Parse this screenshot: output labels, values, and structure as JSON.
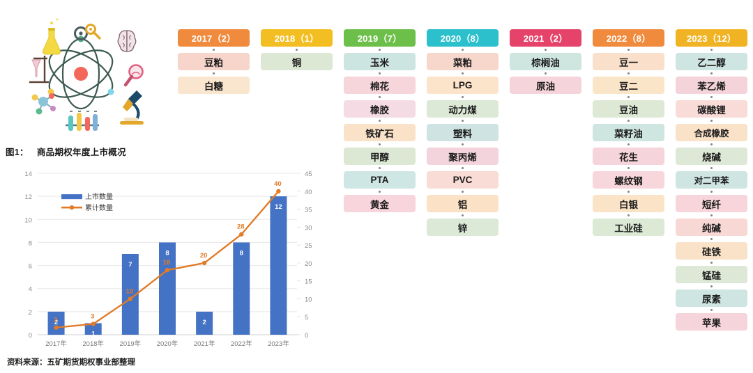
{
  "illustration": {
    "name": "science-illustration",
    "elements": [
      "atom",
      "brain",
      "microscope",
      "flask",
      "magnifier",
      "gears",
      "molecule",
      "test-tubes",
      "beaker-stand"
    ]
  },
  "chart": {
    "title_num": "图1：",
    "title_text": "商品期权年度上市概况",
    "source": "资料来源：五矿期货期权事业部整理",
    "bar_color": "#4472C4",
    "line_color": "#E07B28"
  },
  "chart_data": {
    "type": "bar",
    "title": "图1： 商品期权年度上市概况",
    "categories": [
      "2017年",
      "2018年",
      "2019年",
      "2020年",
      "2021年",
      "2022年",
      "2023年"
    ],
    "series": [
      {
        "name": "上市数量",
        "type": "bar",
        "axis": "left",
        "values": [
          2,
          1,
          7,
          8,
          2,
          8,
          12
        ]
      },
      {
        "name": "累计数量",
        "type": "line",
        "axis": "right",
        "values": [
          2,
          3,
          10,
          18,
          20,
          28,
          40
        ]
      }
    ],
    "xlabel": "",
    "ylabel": "",
    "ylim": [
      0,
      14
    ],
    "y_ticks": [
      0,
      2,
      4,
      6,
      8,
      10,
      12,
      14
    ],
    "y2lim": [
      0,
      45
    ],
    "y2_ticks": [
      0,
      5,
      10,
      15,
      20,
      25,
      30,
      35,
      40,
      45
    ],
    "grid": true,
    "legend_position": "upper-left",
    "legend": [
      "上市数量",
      "累计数量"
    ]
  },
  "columns": [
    {
      "year": "2017（2）",
      "head_color": "#F08A3C",
      "items": [
        {
          "label": "豆粕",
          "color": "#F7D5CB"
        },
        {
          "label": "白糖",
          "color": "#FAE6CF"
        }
      ]
    },
    {
      "year": "2018（1）",
      "head_color": "#F2BE22",
      "items": [
        {
          "label": "铜",
          "color": "#DCE8D4"
        }
      ]
    },
    {
      "year": "2019（7）",
      "head_color": "#6CC04A",
      "items": [
        {
          "label": "玉米",
          "color": "#CDE5E0"
        },
        {
          "label": "棉花",
          "color": "#F6D5DB"
        },
        {
          "label": "橡胶",
          "color": "#F5DCE4"
        },
        {
          "label": "铁矿石",
          "color": "#FAE2C8"
        },
        {
          "label": "甲醇",
          "color": "#DCE8D4"
        },
        {
          "label": "PTA",
          "color": "#CFE7E4"
        },
        {
          "label": "黄金",
          "color": "#F8D4DC"
        }
      ]
    },
    {
      "year": "2020（8）",
      "head_color": "#2BC0CC",
      "items": [
        {
          "label": "菜粕",
          "color": "#F7D6CB"
        },
        {
          "label": "LPG",
          "color": "#FBE4C9"
        },
        {
          "label": "动力煤",
          "color": "#DCE9D6"
        },
        {
          "label": "塑料",
          "color": "#CFE4E2"
        },
        {
          "label": "聚丙烯",
          "color": "#F3D3DC"
        },
        {
          "label": "PVC",
          "color": "#F9DCD6"
        },
        {
          "label": "铝",
          "color": "#FBE2C6"
        },
        {
          "label": "锌",
          "color": "#DCE9D6"
        }
      ]
    },
    {
      "year": "2021（2）",
      "head_color": "#E6436B",
      "items": [
        {
          "label": "棕榈油",
          "color": "#CFE5DF"
        },
        {
          "label": "原油",
          "color": "#F6D4DB"
        }
      ]
    },
    {
      "year": "2022（8）",
      "head_color": "#F08A3C",
      "items": [
        {
          "label": "豆一",
          "color": "#FAE0CA"
        },
        {
          "label": "豆二",
          "color": "#FBE5C9"
        },
        {
          "label": "豆油",
          "color": "#DDE9D5"
        },
        {
          "label": "菜籽油",
          "color": "#CEE5E0"
        },
        {
          "label": "花生",
          "color": "#F6D4DB"
        },
        {
          "label": "螺纹钢",
          "color": "#F7D6DC"
        },
        {
          "label": "白银",
          "color": "#FBE3C8"
        },
        {
          "label": "工业硅",
          "color": "#DCE9D5"
        }
      ]
    },
    {
      "year": "2023（12）",
      "head_color": "#F0B323",
      "items": [
        {
          "label": "乙二醇",
          "color": "#CFE5E2"
        },
        {
          "label": "苯乙烯",
          "color": "#F5D3DA"
        },
        {
          "label": "碳酸锂",
          "color": "#F9DCD8"
        },
        {
          "label": "合成橡胶",
          "color": "#FAE2C9"
        },
        {
          "label": "烧碱",
          "color": "#DDE9D6"
        },
        {
          "label": "对二甲苯",
          "color": "#CFE5E2"
        },
        {
          "label": "短纤",
          "color": "#F7D5DB"
        },
        {
          "label": "纯碱",
          "color": "#F8D8D4"
        },
        {
          "label": "硅铁",
          "color": "#FAE2C9"
        },
        {
          "label": "锰硅",
          "color": "#DDE9D6"
        },
        {
          "label": "尿素",
          "color": "#CEE5E1"
        },
        {
          "label": "苹果",
          "color": "#F6D4DB"
        }
      ]
    }
  ]
}
